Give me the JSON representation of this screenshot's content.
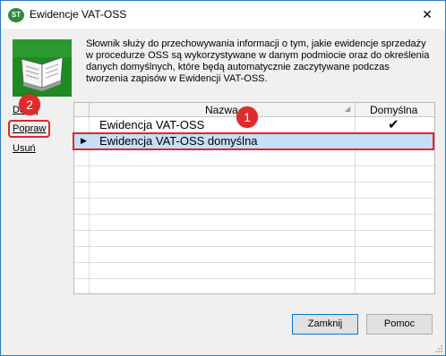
{
  "window": {
    "title": "Ewidencje VAT-OSS",
    "app_icon_text": "ST",
    "close_glyph": "✕"
  },
  "description": "Słownik służy do przechowywania informacji o tym, jakie ewidencje sprzedaży w procedurze OSS są wykorzystywane w danym podmiocie oraz do określenia danych domyślnych, które będą automatycznie zaczytywane podczas tworzenia zapisów w Ewidencji VAT-OSS.",
  "side_actions": {
    "add_label": "Dodaj",
    "edit_label": "Popraw",
    "delete_label": "Usuń"
  },
  "grid": {
    "columns": [
      "Nazwa",
      "Domyślna"
    ],
    "rows": [
      {
        "name": "Ewidencja VAT-OSS",
        "default_mark": "✔",
        "selected": false
      },
      {
        "name": "Ewidencja VAT-OSS domyślna",
        "default_mark": "",
        "selected": true
      }
    ],
    "row_indicator": "▶"
  },
  "callouts": {
    "first": "1",
    "second": "2"
  },
  "buttons": {
    "close_label": "Zamknij",
    "help_label": "Pomoc"
  },
  "colors": {
    "accent_red": "#e0262b",
    "selection": "#c5dff7",
    "icon_green": "#1e8a22"
  },
  "icons": {
    "app": "app-logo-icon",
    "book": "open-book-icon",
    "check": "checkmark-icon"
  }
}
